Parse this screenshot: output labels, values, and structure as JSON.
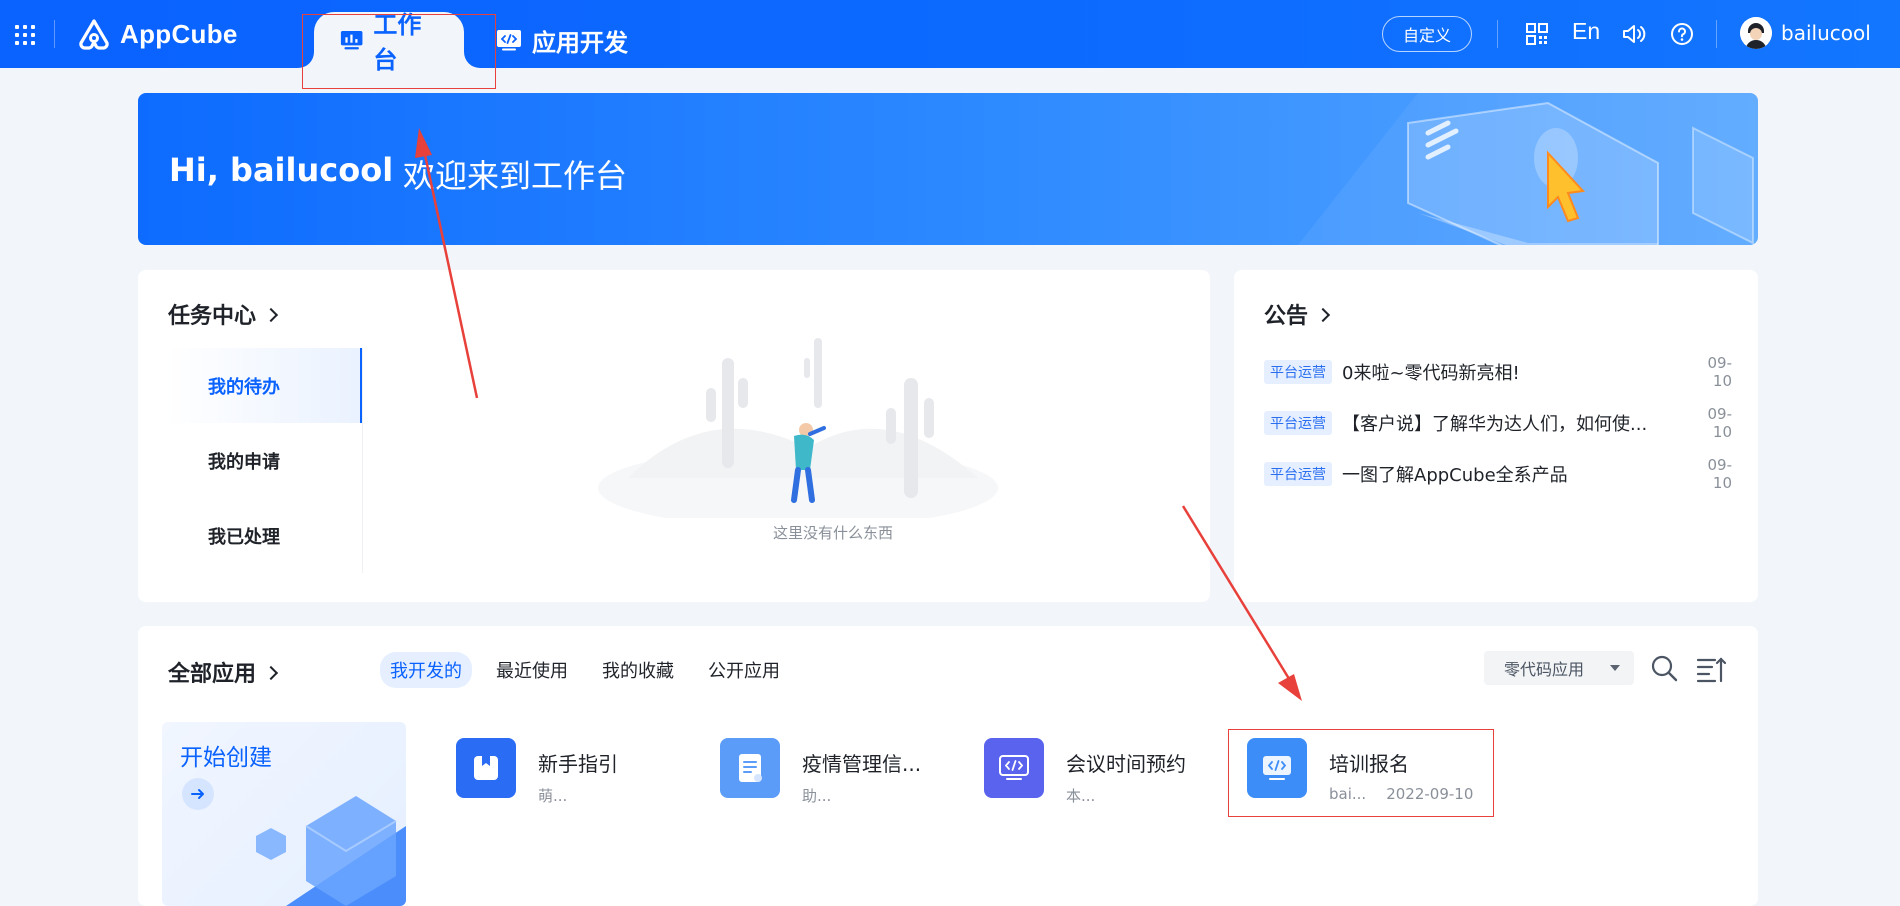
{
  "topbar": {
    "logo_text": "AppCube",
    "tabs": [
      {
        "label": "工作台",
        "active": true
      },
      {
        "label": "应用开发",
        "active": false
      }
    ],
    "customize_label": "自定义",
    "lang_label": "En",
    "username": "bailucool"
  },
  "banner": {
    "greeting": "Hi, bailucool",
    "welcome": "欢迎来到工作台"
  },
  "task_center": {
    "title": "任务中心",
    "nav": [
      {
        "label": "我的待办",
        "active": true
      },
      {
        "label": "我的申请",
        "active": false
      },
      {
        "label": "我已处理",
        "active": false
      }
    ],
    "empty_text": "这里没有什么东西"
  },
  "notices": {
    "title": "公告",
    "items": [
      {
        "tag": "平台运营",
        "text": "0来啦~零代码新亮相!",
        "date": "09-10"
      },
      {
        "tag": "平台运营",
        "text": "【客户说】了解华为达人们，如何使...",
        "date": "09-10"
      },
      {
        "tag": "平台运营",
        "text": "一图了解AppCube全系产品",
        "date": "09-10"
      }
    ]
  },
  "apps": {
    "title": "全部应用",
    "filters": [
      {
        "label": "我开发的",
        "active": true
      },
      {
        "label": "最近使用",
        "active": false
      },
      {
        "label": "我的收藏",
        "active": false
      },
      {
        "label": "公开应用",
        "active": false
      }
    ],
    "type_select": "零代码应用",
    "create_label": "开始创建",
    "items": [
      {
        "name": "新手指引",
        "sub": "萌...",
        "date": "",
        "color": "#2b6cf5"
      },
      {
        "name": "疫情管理信...",
        "sub": "助...",
        "date": "",
        "color": "#5b9cf8"
      },
      {
        "name": "会议时间预约",
        "sub": "本...",
        "date": "",
        "color": "#5a63ee"
      },
      {
        "name": "培训报名",
        "sub": "bai...",
        "date": "2022-09-10",
        "color": "#3c8df7"
      }
    ]
  },
  "colors": {
    "primary": "#0a62ff",
    "annotation_red": "#e8403a"
  }
}
